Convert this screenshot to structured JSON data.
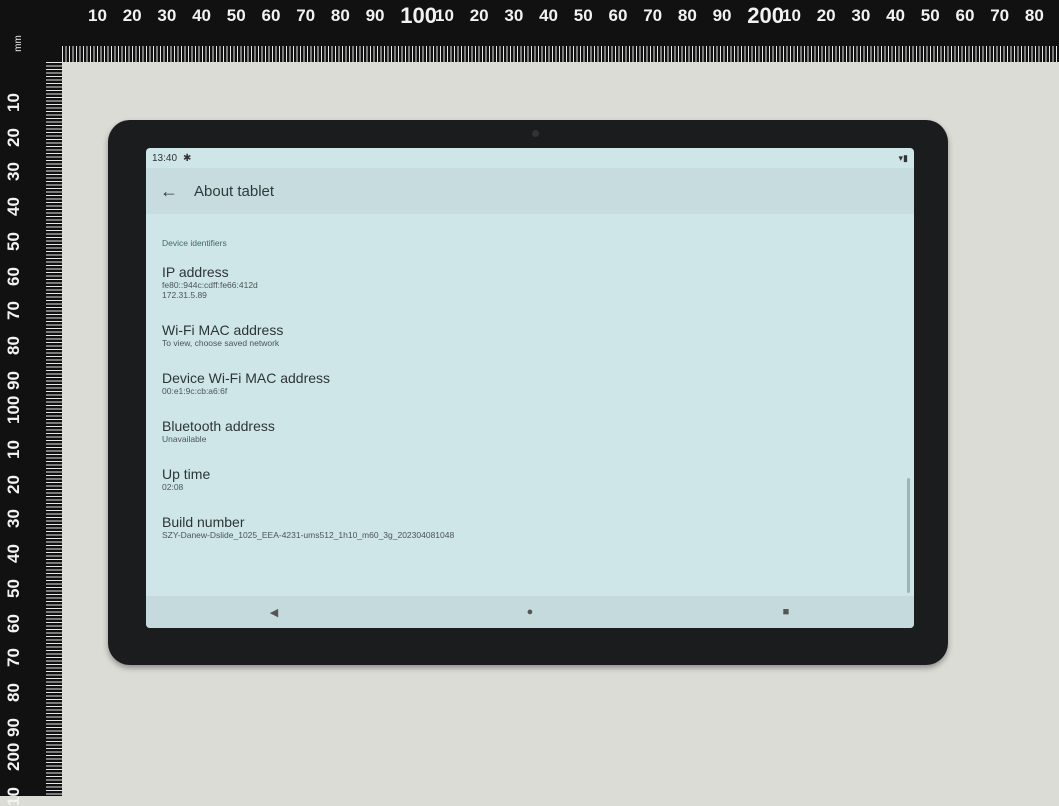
{
  "ruler": {
    "unit": "mm",
    "top_numbers": [
      "10",
      "20",
      "30",
      "40",
      "50",
      "60",
      "70",
      "80",
      "90",
      "100",
      "10",
      "20",
      "30",
      "40",
      "50",
      "60",
      "70",
      "80",
      "90",
      "200",
      "10",
      "20",
      "30",
      "40",
      "50",
      "60",
      "70",
      "80"
    ],
    "left_numbers": [
      "10",
      "20",
      "30",
      "40",
      "50",
      "60",
      "70",
      "80",
      "90",
      "100",
      "10",
      "20",
      "30",
      "40",
      "50",
      "60",
      "70",
      "80",
      "90",
      "200",
      "10"
    ]
  },
  "status_bar": {
    "time": "13:40",
    "settings_icon": "gear-icon",
    "right_icons": "▾▮"
  },
  "app_bar": {
    "back_icon": "←",
    "title": "About tablet"
  },
  "section": {
    "header": "Device identifiers",
    "items": [
      {
        "title": "IP address",
        "subtitle_lines": [
          "fe80::944c:cdff:fe66:412d",
          "172.31.5.89"
        ]
      },
      {
        "title": "Wi-Fi MAC address",
        "subtitle_lines": [
          "To view, choose saved network"
        ]
      },
      {
        "title": "Device Wi-Fi MAC address",
        "subtitle_lines": [
          "00:e1:9c:cb:a6:6f"
        ]
      },
      {
        "title": "Bluetooth address",
        "subtitle_lines": [
          "Unavailable"
        ]
      },
      {
        "title": "Up time",
        "subtitle_lines": [
          "02:08"
        ]
      },
      {
        "title": "Build number",
        "subtitle_lines": [
          "SZY-Danew-Dslide_1025_EEA-4231-ums512_1h10_m60_3g_202304081048"
        ]
      }
    ]
  },
  "nav_bar": {
    "back": "◀",
    "home": "●",
    "recents": "■"
  }
}
